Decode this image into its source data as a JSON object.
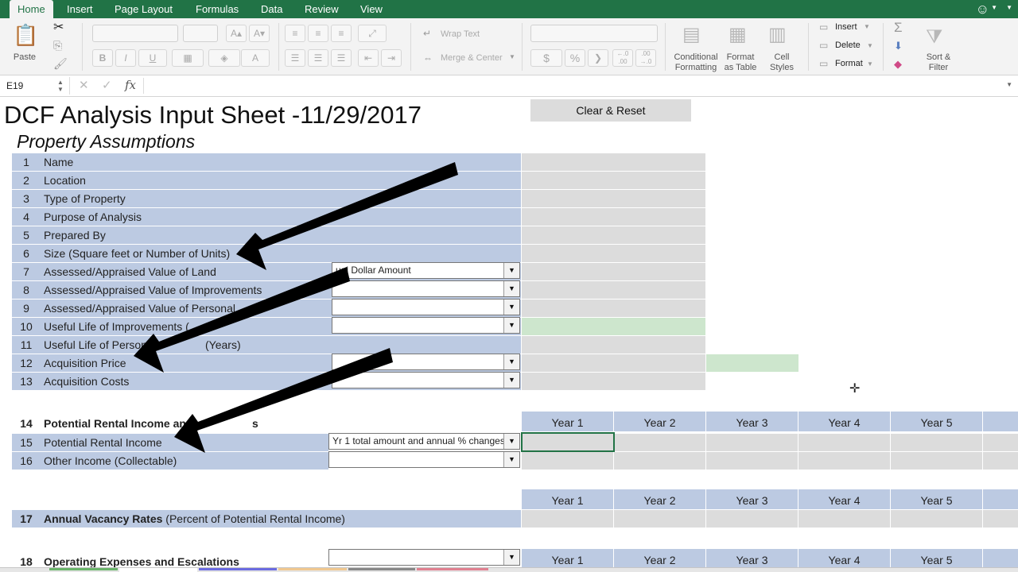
{
  "menu": {
    "tabs": [
      "Home",
      "Insert",
      "Page Layout",
      "Formulas",
      "Data",
      "Review",
      "View"
    ]
  },
  "ribbon": {
    "paste": "Paste",
    "wrap_text": "Wrap Text",
    "merge_center": "Merge & Center",
    "conditional_formatting": [
      "Conditional",
      "Formatting"
    ],
    "format_as_table": [
      "Format",
      "as Table"
    ],
    "cell_styles": [
      "Cell",
      "Styles"
    ],
    "insert": "Insert",
    "delete": "Delete",
    "format": "Format",
    "sort_filter": [
      "Sort &",
      "Filter"
    ],
    "bold": "B",
    "italic": "I",
    "underline": "U",
    "currency": "$",
    "percent": "%",
    "comma": "❯",
    "inc_decimal": "←.0 .00",
    "dec_decimal": ".00 →.0"
  },
  "formula_bar": {
    "cell_ref": "E19",
    "fx": "fx",
    "cancel": "✕",
    "enter": "✓"
  },
  "sheet": {
    "title": "DCF Analysis Input Sheet -11/29/2017",
    "subtitle": "Property Assumptions",
    "clear_button": "Clear & Reset",
    "assumptions": [
      {
        "n": "1",
        "label": "Name"
      },
      {
        "n": "2",
        "label": "Location"
      },
      {
        "n": "3",
        "label": "Type of Property"
      },
      {
        "n": "4",
        "label": "Purpose of Analysis"
      },
      {
        "n": "5",
        "label": "Prepared By"
      },
      {
        "n": "6",
        "label": "Size (Square feet or Number of Units)"
      },
      {
        "n": "7",
        "label": "Assessed/Appraised Value of Land"
      },
      {
        "n": "8",
        "label": "Assessed/Appraised Value of Improvements"
      },
      {
        "n": "9",
        "label": "Assessed/Appraised Value of Personal"
      },
      {
        "n": "10",
        "label": "Useful Life of Improvements ("
      },
      {
        "n": "11",
        "label": "Useful Life of Person"
      },
      {
        "n": "12",
        "label": "Acquisition Price"
      },
      {
        "n": "13",
        "label": "Acquisition Costs"
      }
    ],
    "label_11_tail": "(Years)",
    "dropdown_7": "ual Dollar Amount",
    "dropdown_15": "Yr 1 total amount and annual % changes",
    "row14": {
      "n": "14",
      "label": "Potential Rental Income an",
      "tail": "s"
    },
    "row15": {
      "n": "15",
      "label": "Potential Rental Income"
    },
    "row16": {
      "n": "16",
      "label": "Other Income (Collectable)"
    },
    "row17": {
      "n": "17",
      "label_bold": "Annual Vacancy Rates",
      "label_rest": "(Percent of Potential Rental Income)"
    },
    "row18": {
      "n": "18",
      "label": "Operating Expenses and Escalations"
    },
    "years": [
      "Year 1",
      "Year 2",
      "Year 3",
      "Year 4",
      "Year 5",
      "Y"
    ]
  },
  "colors": {
    "excel_green": "#217346",
    "input_blue": "#bccae2",
    "input_grey": "#dcdcdc",
    "input_green": "#cde6cd",
    "arrow": "#000000"
  }
}
